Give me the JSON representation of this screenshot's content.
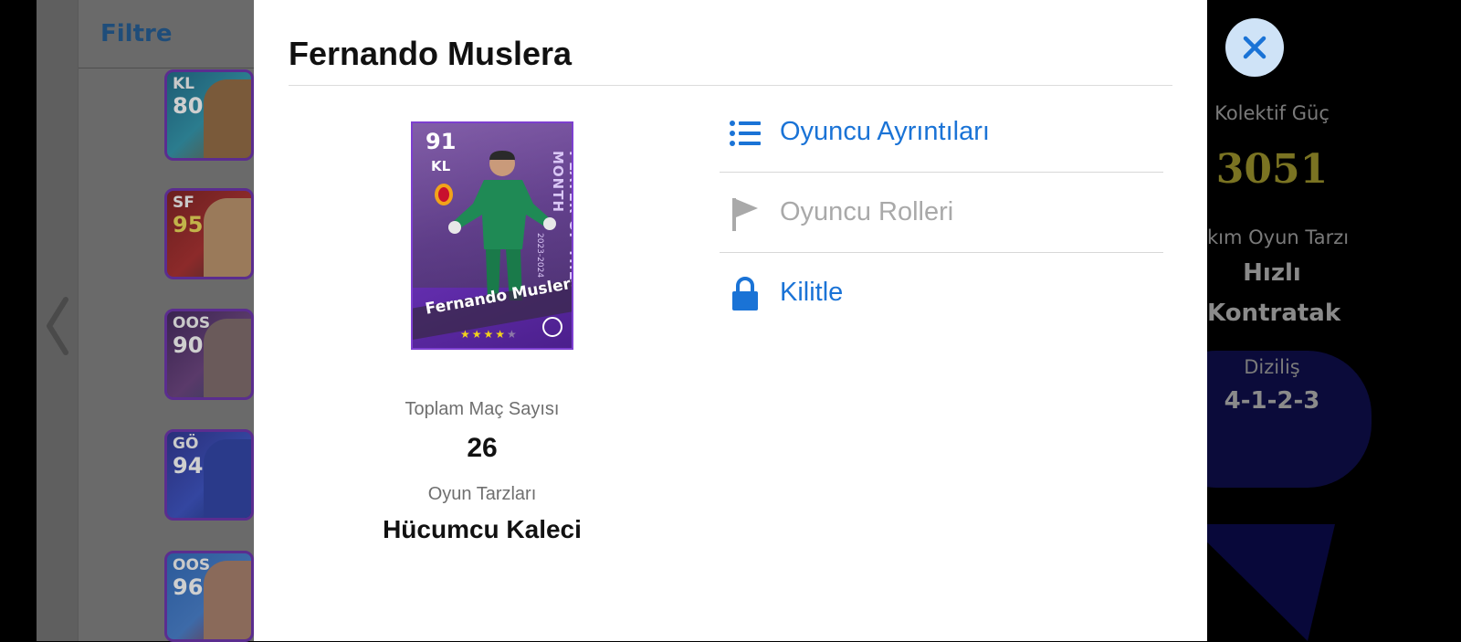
{
  "background_left": {
    "filter_label": "Filtre",
    "cards": [
      {
        "position": "KL",
        "rating": "80"
      },
      {
        "position": "SF",
        "rating": "95"
      },
      {
        "position": "OOS",
        "rating": "90"
      },
      {
        "position": "GÖ",
        "rating": "94"
      },
      {
        "position": "OOS",
        "rating": "96"
      }
    ]
  },
  "background_right": {
    "collective_power_label": "Kolektif Güç",
    "collective_power_value": "3051",
    "team_playstyle_label": "kım Oyun Tarzı",
    "team_playstyle_value_1": "Hızlı",
    "team_playstyle_value_2": "Kontratak",
    "formation_label": "Diziliş",
    "formation_value": "4-1-2-3"
  },
  "modal": {
    "player_name": "Fernando Muslera",
    "card": {
      "rating": "91",
      "position": "KL",
      "name": "Fernando Muslera",
      "side_text": "PLAYER OF THE MONTH",
      "year": "2023-2024",
      "stars": 4,
      "color": "#7d3fd0"
    },
    "total_matches_label": "Toplam Maç Sayısı",
    "total_matches_value": "26",
    "playstyles_label": "Oyun Tarzları",
    "playstyles_value": "Hücumcu Kaleci",
    "menu": [
      {
        "label": "Oyuncu Ayrıntıları",
        "icon": "list-icon",
        "enabled": true
      },
      {
        "label": "Oyuncu Rolleri",
        "icon": "flag-icon",
        "enabled": false
      },
      {
        "label": "Kilitle",
        "icon": "lock-icon",
        "enabled": true
      }
    ],
    "accent_color": "#1a73d6"
  }
}
